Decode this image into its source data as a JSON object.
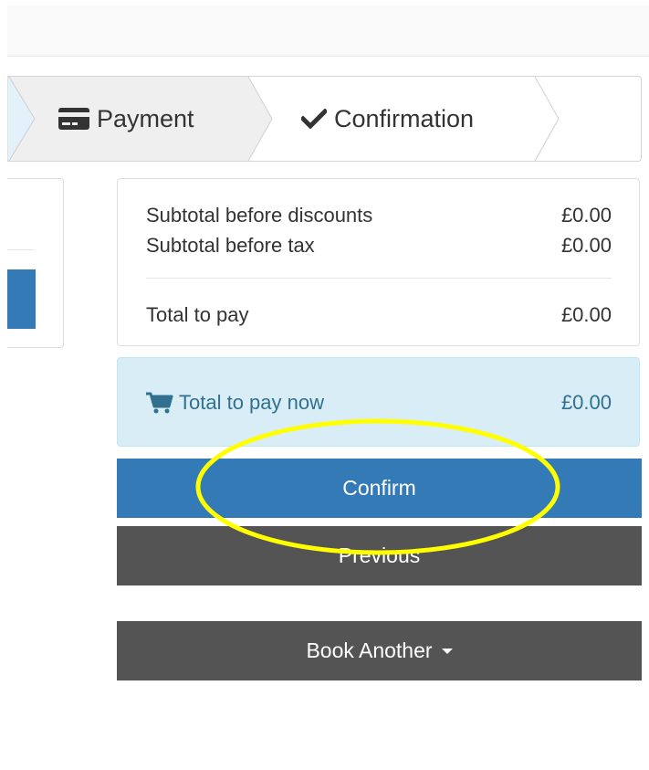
{
  "wizard": {
    "steps": [
      {
        "label": "Payment",
        "icon": "credit-card-icon"
      },
      {
        "label": "Confirmation",
        "icon": "checkmark-icon"
      }
    ]
  },
  "summary": {
    "subtotal_before_discounts_label": "Subtotal before discounts",
    "subtotal_before_discounts_value": "£0.00",
    "subtotal_before_tax_label": "Subtotal before tax",
    "subtotal_before_tax_value": "£0.00",
    "total_to_pay_label": "Total to pay",
    "total_to_pay_value": "£0.00"
  },
  "total_now": {
    "icon": "shopping-cart-icon",
    "label": "Total to pay now",
    "value": "£0.00"
  },
  "buttons": {
    "confirm_label": "Confirm",
    "previous_label": "Previous",
    "book_another_label": "Book Another"
  },
  "annotation": {
    "color": "#ffff00"
  },
  "colors": {
    "primary": "#337ab7",
    "dark": "#545454",
    "info_bg": "#d9edf7",
    "info_text": "#31708f"
  }
}
